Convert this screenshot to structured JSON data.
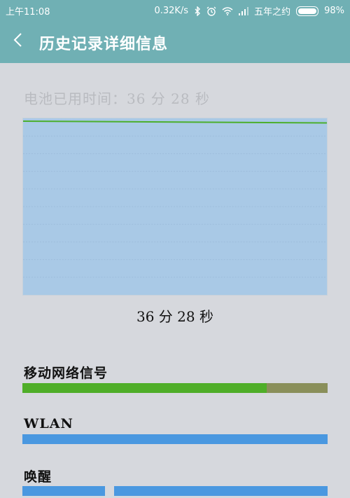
{
  "status_bar": {
    "time": "上午11:08",
    "net_speed": "0.32K/s",
    "carrier": "五年之约",
    "battery_percent": "98%",
    "battery_level": 0.98,
    "icons": [
      "bluetooth-icon",
      "alarm-icon",
      "wifi-icon",
      "signal-icon",
      "battery-icon"
    ]
  },
  "header": {
    "title": "历史记录详细信息",
    "back_icon": "chevron-left-icon",
    "background": "#70b0b4"
  },
  "battery_usage": {
    "label": "电池已用时间：36 分 28 秒",
    "caption": "36 分 28 秒"
  },
  "chart_data": {
    "type": "area",
    "x": [
      0,
      1
    ],
    "values": [
      100,
      99
    ],
    "ylim": [
      0,
      100
    ],
    "grid": true,
    "colors": {
      "fill": "#a9c9e6",
      "line": "#4caf2c",
      "grid": "#8fb0cf"
    }
  },
  "sections": [
    {
      "name": "移动网络信号",
      "bars": [
        {
          "fraction": 0.8,
          "color": "#4fae28"
        },
        {
          "fraction": 0.2,
          "color": "#8a8f5a"
        }
      ]
    },
    {
      "name": "WLAN",
      "bars": [
        {
          "fraction": 1.0,
          "color": "#4a98e0"
        }
      ]
    },
    {
      "name": "唤醒",
      "bars": [
        {
          "fraction": 0.27,
          "color": "#4a98e0"
        },
        {
          "fraction": 0.03,
          "color": "#d6d8dd"
        },
        {
          "fraction": 0.7,
          "color": "#4a98e0"
        }
      ]
    }
  ]
}
